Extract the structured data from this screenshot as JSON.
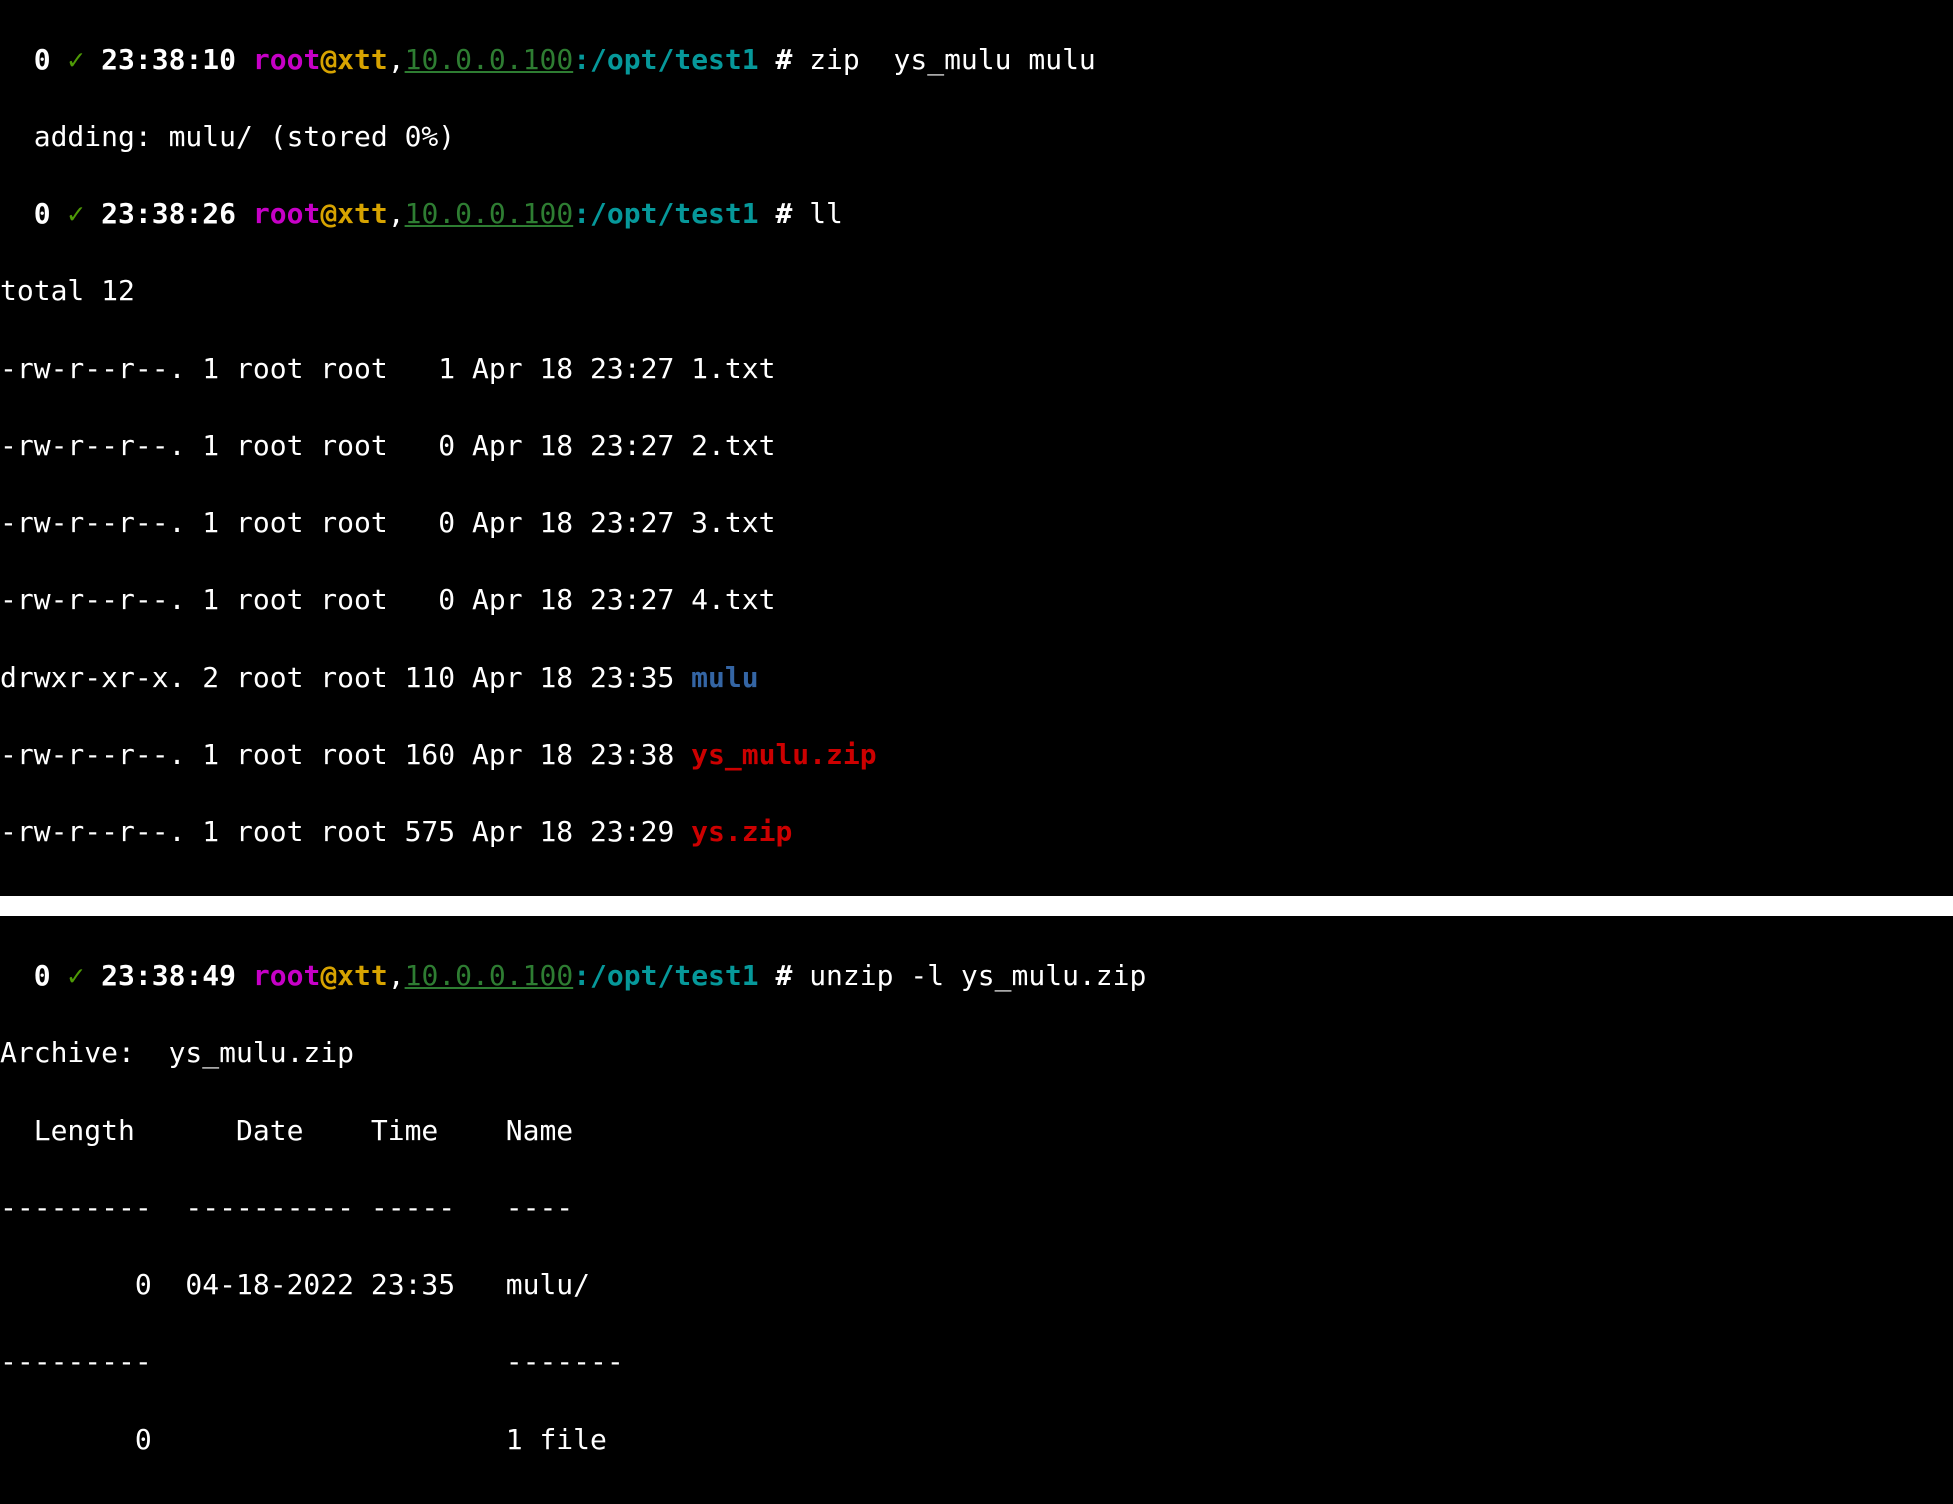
{
  "blocks": [
    {
      "prompt": {
        "exit": "0",
        "check": "✓",
        "time": "23:38:10",
        "user": "root",
        "at": "@",
        "host": "xtt",
        "comma": ",",
        "ip": "10.0.0.100",
        "colon1": ":",
        "path": "/opt/test1",
        "hash": " # ",
        "command": "zip  ys_mulu mulu"
      },
      "output_lines": [
        "  adding: mulu/ (stored 0%)"
      ],
      "ll": {
        "prompt": {
          "exit": "0",
          "check": "✓",
          "time": "23:38:26",
          "user": "root",
          "at": "@",
          "host": "xtt",
          "comma": ",",
          "ip": "10.0.0.100",
          "colon1": ":",
          "path": "/opt/test1",
          "hash": " # ",
          "command": "ll"
        },
        "total": "total 12",
        "entries": [
          {
            "meta": "-rw-r--r--. 1 root root   1 Apr 18 23:27 ",
            "name": "1.txt",
            "cls": "white"
          },
          {
            "meta": "-rw-r--r--. 1 root root   0 Apr 18 23:27 ",
            "name": "2.txt",
            "cls": "white"
          },
          {
            "meta": "-rw-r--r--. 1 root root   0 Apr 18 23:27 ",
            "name": "3.txt",
            "cls": "white"
          },
          {
            "meta": "-rw-r--r--. 1 root root   0 Apr 18 23:27 ",
            "name": "4.txt",
            "cls": "white"
          },
          {
            "meta": "drwxr-xr-x. 2 root root 110 Apr 18 23:35 ",
            "name": "mulu",
            "cls": "dir"
          },
          {
            "meta": "-rw-r--r--. 1 root root 160 Apr 18 23:38 ",
            "name": "ys_mulu.zip",
            "cls": "zip"
          },
          {
            "meta": "-rw-r--r--. 1 root root 575 Apr 18 23:29 ",
            "name": "ys.zip",
            "cls": "zip"
          }
        ]
      }
    },
    {
      "prompt": {
        "exit": "0",
        "check": "✓",
        "time": "23:38:49",
        "user": "root",
        "at": "@",
        "host": "xtt",
        "comma": ",",
        "ip": "10.0.0.100",
        "colon1": ":",
        "path": "/opt/test1",
        "hash": " # ",
        "command": "unzip -l ys_mulu.zip"
      },
      "unzip": {
        "archive": "Archive:  ys_mulu.zip",
        "header": "  Length      Date    Time    Name",
        "rule1": "---------  ---------- -----   ----",
        "row": "        0  04-18-2022 23:35   mulu/",
        "rule2": "---------                     -------",
        "footer": "        0                     1 file"
      }
    }
  ]
}
